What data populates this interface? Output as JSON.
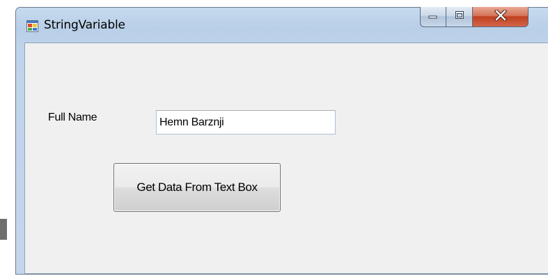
{
  "window": {
    "title": "StringVariable",
    "icon": "winforms-app-icon"
  },
  "caption_buttons": {
    "minimize_icon": "minimize-icon",
    "maximize_icon": "maximize-icon",
    "close_icon": "close-icon",
    "close_color": "#c7472a"
  },
  "form": {
    "full_name_label": "Full Name",
    "full_name_value": "Hemn Barznji",
    "get_data_button": "Get Data From Text Box"
  },
  "colors": {
    "client_background": "#f0f0f0",
    "frame": "#bfd3ea",
    "button_border": "#707070"
  }
}
